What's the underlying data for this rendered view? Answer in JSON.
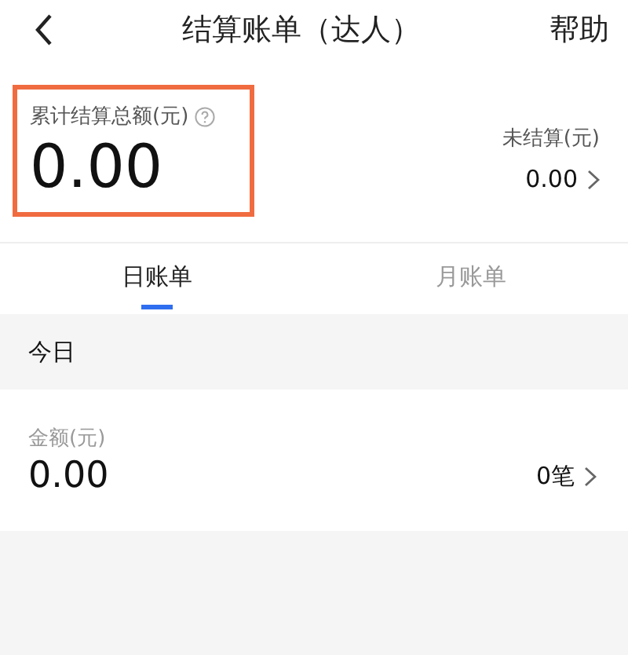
{
  "header": {
    "title": "结算账单（达人）",
    "help": "帮助"
  },
  "summary": {
    "total_label": "累计结算总额(元)",
    "total": "0.00",
    "highlighted": true,
    "unsettled_label": "未结算(元)",
    "unsettled": "0.00"
  },
  "tabs": [
    {
      "label": "日账单",
      "selected": true
    },
    {
      "label": "月账单",
      "selected": false
    }
  ],
  "section": {
    "title": "今日"
  },
  "card": {
    "label": "金额(元)",
    "amount": "0.00",
    "count": "0笔"
  }
}
